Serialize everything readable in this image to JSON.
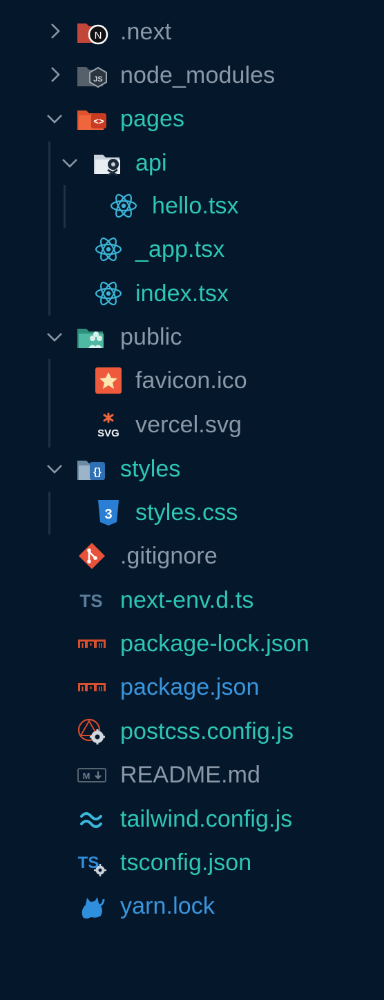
{
  "explorer": {
    "items": [
      {
        "label": ".next",
        "icon": "nextjs-folder-icon",
        "color": "#8a98a8"
      },
      {
        "label": "node_modules",
        "icon": "node-folder-icon",
        "color": "#8a98a8"
      },
      {
        "label": "pages",
        "icon": "pages-folder-icon",
        "color": "#2ec6b4"
      },
      {
        "label": "api",
        "icon": "api-folder-icon",
        "color": "#2ec6b4"
      },
      {
        "label": "hello.tsx",
        "icon": "react-icon",
        "color": "#2ec6b4"
      },
      {
        "label": "_app.tsx",
        "icon": "react-icon",
        "color": "#2ec6b4"
      },
      {
        "label": "index.tsx",
        "icon": "react-icon",
        "color": "#2ec6b4"
      },
      {
        "label": "public",
        "icon": "public-folder-icon",
        "color": "#8a98a8"
      },
      {
        "label": "favicon.ico",
        "icon": "favicon-icon",
        "color": "#8a98a8"
      },
      {
        "label": "vercel.svg",
        "icon": "svg-file-icon",
        "color": "#8a98a8"
      },
      {
        "label": "styles",
        "icon": "styles-folder-icon",
        "color": "#2ec6b4"
      },
      {
        "label": "styles.css",
        "icon": "css3-icon",
        "color": "#2ec6b4"
      },
      {
        "label": ".gitignore",
        "icon": "git-icon",
        "color": "#8a98a8"
      },
      {
        "label": "next-env.d.ts",
        "icon": "typescript-icon",
        "color": "#2ec6b4"
      },
      {
        "label": "package-lock.json",
        "icon": "npm-icon",
        "color": "#2ec6b4"
      },
      {
        "label": "package.json",
        "icon": "npm-icon",
        "color": "#3a96dd"
      },
      {
        "label": "postcss.config.js",
        "icon": "postcss-icon",
        "color": "#2ec6b4"
      },
      {
        "label": "README.md",
        "icon": "markdown-icon",
        "color": "#8a98a8"
      },
      {
        "label": "tailwind.config.js",
        "icon": "tailwind-icon",
        "color": "#2ec6b4"
      },
      {
        "label": "tsconfig.json",
        "icon": "tsconfig-icon",
        "color": "#2ec6b4"
      },
      {
        "label": "yarn.lock",
        "icon": "yarn-icon",
        "color": "#3a96dd"
      }
    ]
  }
}
